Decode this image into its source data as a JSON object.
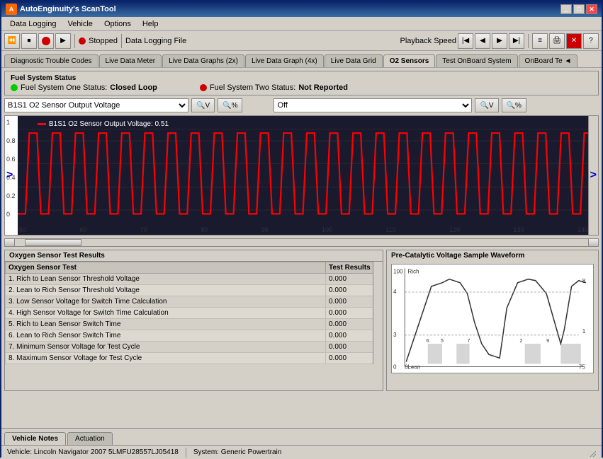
{
  "titlebar": {
    "title": "AutoEnginuity's ScanTool",
    "buttons": [
      "_",
      "□",
      "✕"
    ]
  },
  "menu": {
    "items": [
      "Data Logging",
      "Vehicle",
      "Options",
      "Help"
    ]
  },
  "toolbar": {
    "status": "Stopped",
    "file_label": "Data Logging File",
    "playback_label": "Playback Speed"
  },
  "tabs": [
    "Diagnostic Trouble Codes",
    "Live Data Meter",
    "Live Data Graphs (2x)",
    "Live Data Graph (4x)",
    "Live Data Grid",
    "O2 Sensors",
    "Test OnBoard System",
    "OnBoard Te ◄"
  ],
  "active_tab": "O2 Sensors",
  "fuel_status": {
    "label": "Fuel System Status",
    "one_label": "Fuel System One Status:",
    "one_value": "Closed Loop",
    "two_label": "Fuel System Two Status:",
    "two_value": "Not Reported"
  },
  "sensor_selector": {
    "selected": "B1S1 O2 Sensor Output Voltage",
    "second_selected": "Off"
  },
  "graph": {
    "legend_label": "B1S1 O2 Sensor Output Voltage: 0.51",
    "y_axis": [
      "1",
      "0.8",
      "0.6",
      "0.4",
      "0.2",
      "0"
    ],
    "x_axis": [
      "50",
      "60",
      "70",
      "80",
      "90",
      "100",
      "110",
      "120",
      "130",
      "140"
    ]
  },
  "oxygen_tests": {
    "title": "Oxygen Sensor Test Results",
    "columns": [
      "Oxygen Sensor Test",
      "Test Results"
    ],
    "rows": [
      {
        "test": "1. Rich to Lean Sensor Threshold Voltage",
        "result": "0.000"
      },
      {
        "test": "2. Lean to Rich Sensor Threshold Voltage",
        "result": "0.000"
      },
      {
        "test": "3. Low Sensor Voltage for Switch Time Calculation",
        "result": "0.000"
      },
      {
        "test": "4. High Sensor Voltage for Switch Time Calculation",
        "result": "0.000"
      },
      {
        "test": "5. Rich to Lean Sensor Switch Time",
        "result": "0.000"
      },
      {
        "test": "6. Lean to Rich Sensor Switch Time",
        "result": "0.000"
      },
      {
        "test": "7. Minimum Sensor Voltage for Test Cycle",
        "result": "0.000"
      },
      {
        "test": "8. Maximum Sensor Voltage for Test Cycle",
        "result": "0.000"
      }
    ]
  },
  "waveform": {
    "title": "Pre-Catalytic Voltage Sample Waveform",
    "labels": {
      "rich": "Rich",
      "lean": "Lean",
      "y_top": "100",
      "y_4": "4",
      "y_3": "3",
      "y_0": "0",
      "x_0": "0",
      "x_75": "75"
    },
    "points": [
      "6",
      "5",
      "7",
      "2",
      "9",
      "1"
    ],
    "numbers": [
      "8",
      "1"
    ]
  },
  "bottom_tabs": [
    "Vehicle Notes",
    "Actuation"
  ],
  "active_bottom_tab": "Vehicle Notes",
  "status_bar": {
    "vehicle": "Vehicle: Lincoln Navigator  2007  5LMFU28557LJ05418",
    "system": "System: Generic Powertrain"
  }
}
